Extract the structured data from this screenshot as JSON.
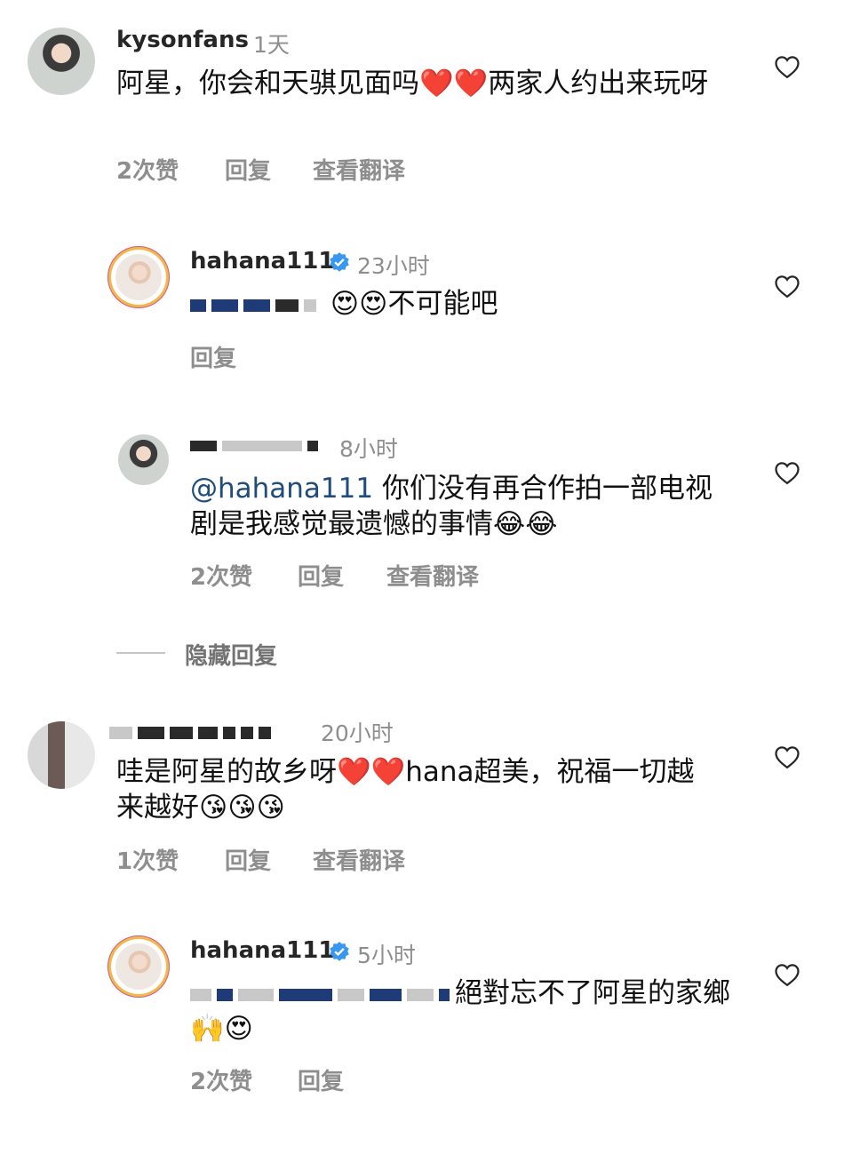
{
  "comments": [
    {
      "username": "kysonfans",
      "time": "1天",
      "text": "阿星，你会和天骐见面吗❤️❤️两家人约出来玩呀",
      "likes": "2次赞",
      "reply": "回复",
      "translate": "查看翻译"
    },
    {
      "username": "hahana111",
      "verified": true,
      "time": "23小时",
      "text": "😍😍不可能吧",
      "reply": "回复"
    },
    {
      "username": "",
      "time": "8小时",
      "mention": "@hahana111",
      "text": " 你们没有再合作拍一部电视剧是我感觉最遗憾的事情😂😂",
      "likes": "2次赞",
      "reply": "回复",
      "translate": "查看翻译"
    },
    {
      "hide_replies": "隐藏回复"
    },
    {
      "username": "",
      "time": "20小时",
      "text": "哇是阿星的故乡呀❤️❤️hana超美，祝福一切越来越好😘😘😘",
      "likes": "1次赞",
      "reply": "回复",
      "translate": "查看翻译"
    },
    {
      "username": "hahana111",
      "verified": true,
      "time": "5小时",
      "text": "絕對忘不了阿星的家鄉🙌😍",
      "likes": "2次赞",
      "reply": "回复"
    }
  ],
  "icons": {
    "like": "heart-outline-icon",
    "verified": "verified-badge-icon"
  },
  "colors": {
    "mention": "#1f4c7a",
    "verified": "#3897f0",
    "secondary_text": "#8e8e8e"
  }
}
